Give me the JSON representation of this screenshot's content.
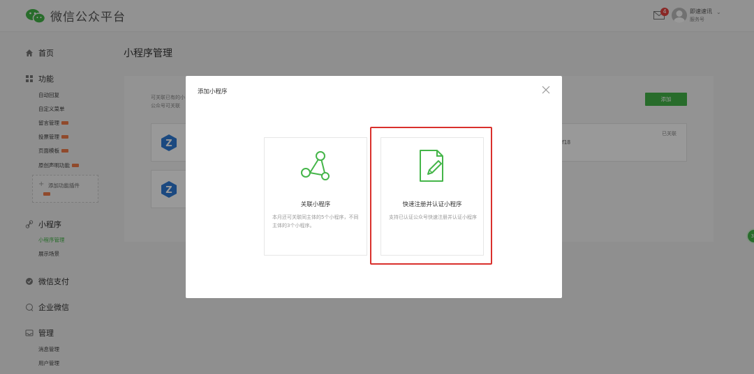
{
  "header": {
    "brand": "微信公众平台",
    "mail_count": "4",
    "user_name": "即速速讯",
    "user_type": "服务号"
  },
  "sidebar": {
    "home": "首页",
    "function": {
      "label": "功能",
      "items": [
        {
          "label": "自动回复",
          "new": false
        },
        {
          "label": "自定义菜单",
          "new": false
        },
        {
          "label": "留言管理",
          "new": true
        },
        {
          "label": "投票管理",
          "new": true
        },
        {
          "label": "页面模板",
          "new": true
        },
        {
          "label": "原创声明功能",
          "new": true
        }
      ],
      "add_plugin": "添加功能插件"
    },
    "miniprogram": {
      "label": "小程序",
      "items": [
        {
          "label": "小程序管理",
          "active": true
        },
        {
          "label": "展示场景",
          "active": false
        }
      ]
    },
    "wechat_pay": "微信支付",
    "work_wechat": "企业微信",
    "manage": {
      "label": "管理",
      "items": [
        "消息管理",
        "用户管理"
      ]
    }
  },
  "main": {
    "title": "小程序管理",
    "intro_line1": "可关联已有的小",
    "intro_line2": "公众号可关联",
    "add_button": "添加",
    "card_status": "已关联",
    "card_meta": "f18",
    "float_badge": "33"
  },
  "modal": {
    "title": "添加小程序",
    "options": [
      {
        "title": "关联小程序",
        "desc": "本月还可关联同主体的5个小程序，不同主体的3个小程序。",
        "icon": "share-nodes-icon"
      },
      {
        "title": "快速注册并认证小程序",
        "desc": "支持已认证公众号快速注册并认证小程序",
        "icon": "document-edit-icon"
      }
    ]
  },
  "colors": {
    "brand_green": "#44b549",
    "highlight_red": "#d9302c",
    "badge_red": "#e64340",
    "new_tag": "#f07c4a"
  }
}
